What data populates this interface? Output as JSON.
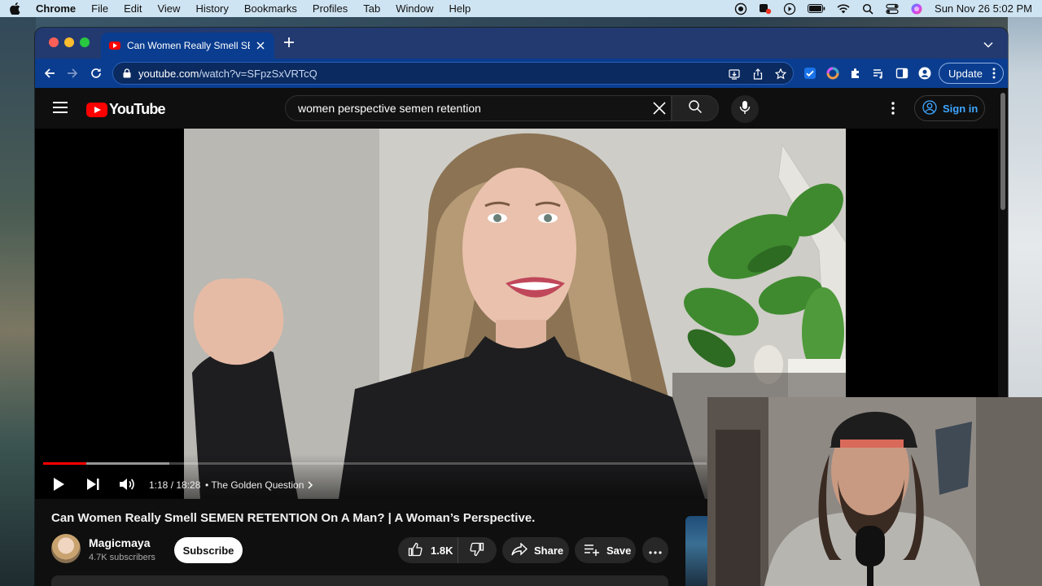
{
  "menubar": {
    "app_name": "Chrome",
    "items": [
      "File",
      "Edit",
      "View",
      "History",
      "Bookmarks",
      "Profiles",
      "Tab",
      "Window",
      "Help"
    ],
    "clock": "Sun Nov 26  5:02 PM"
  },
  "browser": {
    "tab_title": "Can Women Really Smell SEMEN RETENTION On A Man? | A Woman's Perspective. - YouTube",
    "url_host": "youtube.com",
    "url_path": "/watch?v=SFpzSxVRTcQ",
    "update_label": "Update"
  },
  "youtube": {
    "logo_text": "YouTube",
    "search_value": "women perspective semen retention",
    "sign_in_label": "Sign in"
  },
  "player": {
    "progress": 0.065,
    "buffered": 0.19,
    "time": "1:18 / 18:28",
    "chapter": "• The Golden Question",
    "colors": {
      "played": "#ff0000"
    }
  },
  "video": {
    "title": "Can Women Really Smell SEMEN RETENTION On A Man? | A Woman’s Perspective.",
    "channel": "Magicmaya",
    "subscribers": "4.7K subscribers",
    "subscribe_label": "Subscribe",
    "likes": "1.8K",
    "share_label": "Share",
    "save_label": "Save"
  }
}
